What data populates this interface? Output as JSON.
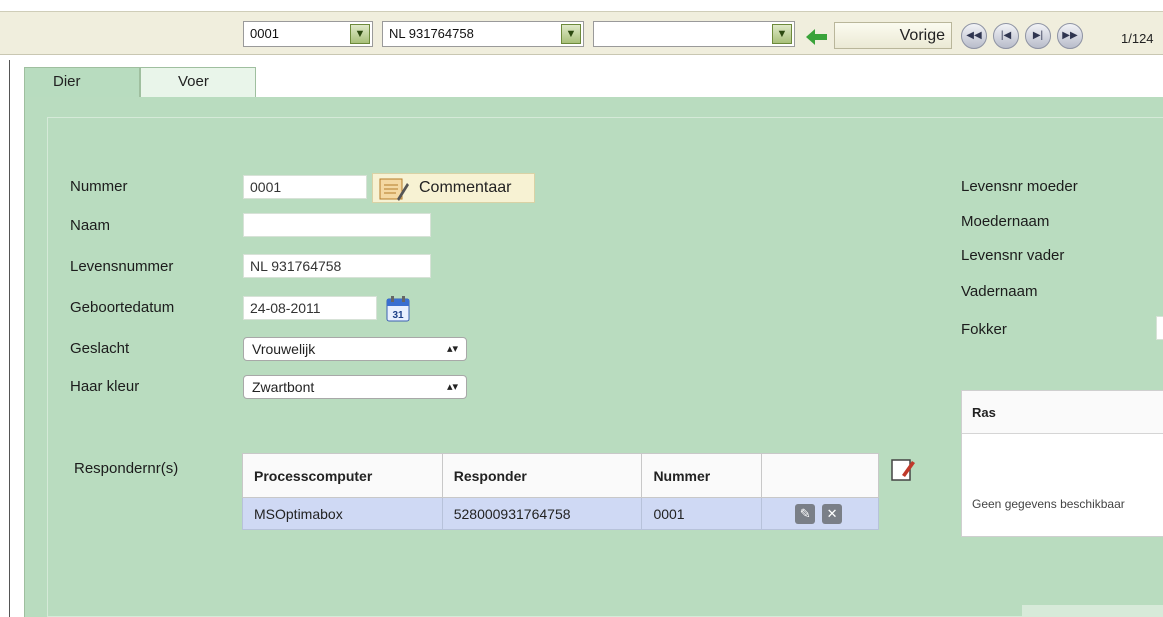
{
  "toolbar": {
    "combo1": "0001",
    "combo2": "NL 931764758",
    "combo3": "",
    "prev_label": "Vorige",
    "pager": "1/124"
  },
  "tabs": [
    {
      "label": "Dier",
      "active": true
    },
    {
      "label": "Voer",
      "active": false
    }
  ],
  "form": {
    "nummer_label": "Nummer",
    "nummer_value": "0001",
    "comment_label": "Commentaar",
    "naam_label": "Naam",
    "naam_value": "",
    "levensnummer_label": "Levensnummer",
    "levensnummer_value": "NL 931764758",
    "geboortedatum_label": "Geboortedatum",
    "geboortedatum_value": "24-08-2011",
    "geslacht_label": "Geslacht",
    "geslacht_value": "Vrouwelijk",
    "haarkleur_label": "Haar kleur",
    "haarkleur_value": "Zwartbont",
    "respondernr_label": "Respondernr(s)"
  },
  "right_labels": {
    "levensnr_moeder": "Levensnr moeder",
    "moedernaam": "Moedernaam",
    "levensnr_vader": "Levensnr vader",
    "vadernaam": "Vadernaam",
    "fokker": "Fokker"
  },
  "responder_table": {
    "headers": [
      "Processcomputer",
      "Responder",
      "Nummer",
      ""
    ],
    "rows": [
      [
        "MSOptimabox",
        "528000931764758",
        "0001"
      ]
    ]
  },
  "ras_panel": {
    "header": "Ras",
    "empty": "Geen gegevens beschikbaar"
  },
  "colors": {
    "panel_bg": "#b9dcbf",
    "toolbar_bg": "#f0eedd",
    "row_selected": "#cfd9f4"
  },
  "icons": [
    "chevron-down-icon",
    "green-left-arrow-icon",
    "rewind-icon",
    "first-icon",
    "last-icon",
    "fast-forward-icon",
    "notepad-icon",
    "calendar-icon",
    "edit-icon",
    "delete-icon",
    "add-note-icon"
  ]
}
